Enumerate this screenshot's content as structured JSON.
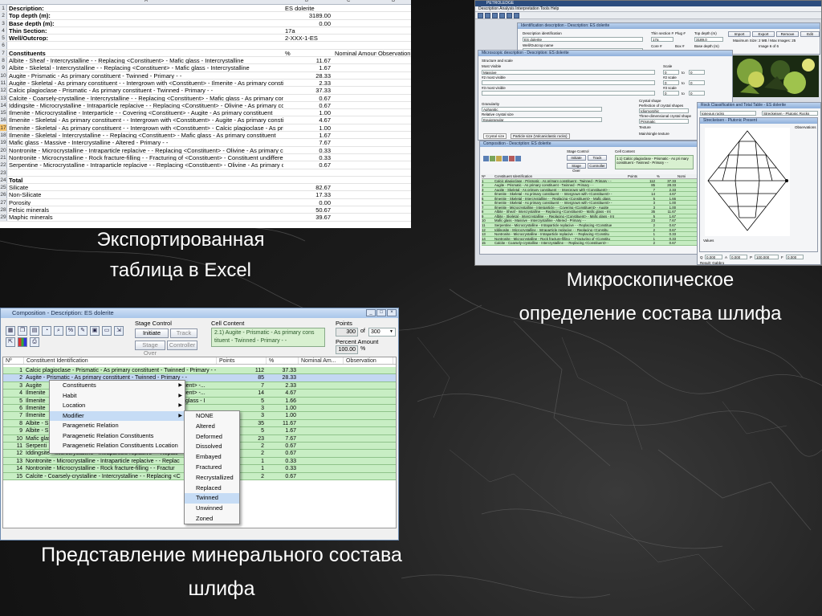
{
  "excel": {
    "col_headers": [
      "A",
      "B",
      "C",
      "D"
    ],
    "rows": [
      {
        "n": "1",
        "a": "Description:",
        "b": "ES dolerite",
        "bl": true,
        "bold": true
      },
      {
        "n": "2",
        "a": "Top depth (m):",
        "b": "3189.00",
        "bold": true
      },
      {
        "n": "3",
        "a": "Base depth (m):",
        "b": "0.00",
        "bold": true
      },
      {
        "n": "4",
        "a": "Thin Section:",
        "b": "17a",
        "bl": true,
        "bold": true
      },
      {
        "n": "5",
        "a": "Well/Outcrop:",
        "b": "2-XXX-1-ES",
        "bl": true,
        "bold": true
      },
      {
        "n": "6",
        "a": ""
      },
      {
        "n": "7",
        "a": "Constituents",
        "b": "%",
        "bl": true,
        "c": "Nominal Amount",
        "d": "Observation",
        "bold": true
      },
      {
        "n": "8",
        "a": "Albite - Sheaf - Intercrystalline - - Replacing <Constituent> - Mafic glass - Intercrystalline",
        "b": "11.67"
      },
      {
        "n": "9",
        "a": "Albite - Skeletal - Intercrystalline - - Replacing <Constituent> - Mafic glass - Intercrystalline",
        "b": "1.67"
      },
      {
        "n": "10",
        "a": "Augite - Prismatic - As primary constituent - Twinned - Primary - -",
        "b": "28.33"
      },
      {
        "n": "11",
        "a": "Augite - Skeletal - As primary constituent - - Intergrown with <Constituent> - Ilmenite - As primary constitu",
        "b": "2.33"
      },
      {
        "n": "12",
        "a": "Calcic plagioclase - Prismatic - As primary constituent - Twinned - Primary - -",
        "b": "37.33"
      },
      {
        "n": "13",
        "a": "Calcite - Coarsely-crystalline - Intercrystalline - - Replacing <Constituent> - Mafic glass - As primary consti",
        "b": "0.67"
      },
      {
        "n": "14",
        "a": "Iddingsite - Microcrystalline - Intraparticle replacive - - Replacing <Constituent> - Olivine - As primary consti",
        "b": "0.67"
      },
      {
        "n": "15",
        "a": "Ilmenite - Microcrystalline - Interparticle - - Covering <Constituent> - Augite - As primary constituent",
        "b": "1.00"
      },
      {
        "n": "16",
        "a": "Ilmenite - Skeletal - As primary constituent - - Intergrown with <Constituent> - Augite - As primary constitu",
        "b": "4.67"
      },
      {
        "n": "17",
        "a": "Ilmenite - Skeletal - As primary constituent - - Intergrown with <Constituent> - Calcic plagioclase - As prim",
        "b": "1.00",
        "sel": true
      },
      {
        "n": "18",
        "a": "Ilmenite - Skeletal - Intercrystalline - - Replacing <Constituent> - Mafic glass - As primary constituent",
        "b": "1.67"
      },
      {
        "n": "19",
        "a": "Mafic glass - Massive - Intercrystalline - Altered - Primary - -",
        "b": "7.67"
      },
      {
        "n": "20",
        "a": "Nontronite - Microcrystalline - Intraparticle replacive - - Replacing <Constituent> - Olivine - As primary cons",
        "b": "0.33"
      },
      {
        "n": "21",
        "a": "Nontronite - Microcrystalline - Rock fracture-filling - - Fracturing of <Constituent> - Constituent undifferentiat",
        "b": "0.33"
      },
      {
        "n": "22",
        "a": "Serpentine - Microcrystalline - Intraparticle replacive - - Replacing <Constituent> - Olivine - As primary cons",
        "b": "0.67"
      },
      {
        "n": "23",
        "a": ""
      },
      {
        "n": "24",
        "a": "Total",
        "bold": true
      },
      {
        "n": "25",
        "a": "Silicate",
        "b": "82.67"
      },
      {
        "n": "26",
        "a": "Non-Silicate",
        "b": "17.33"
      },
      {
        "n": "27",
        "a": "Porosity",
        "b": "0.00"
      },
      {
        "n": "28",
        "a": "Felsic minerals",
        "b": "50.67"
      },
      {
        "n": "29",
        "a": "Maphic minerals",
        "b": "39.67"
      }
    ]
  },
  "captions": {
    "excel_line1": "Экспортированная",
    "excel_line2": "таблица в Excel",
    "micro_line1": "Микроскопическое",
    "micro_line2": "определение состава шлифа",
    "comp_line1": "Представление минерального состава",
    "comp_line2": "шлифа"
  },
  "app": {
    "title": "PETROLEDGE",
    "menu": "Description   Analysis   Interpretation   Tools   Help",
    "ident": {
      "title": "Identification description - Description: ES dolerite",
      "desc_label": "Description identification",
      "desc_value": "ES dolerite",
      "well_label": "Well/Outcrop name",
      "thin_label": "Thin section #",
      "plug_label": "Plug #",
      "top_label": "Top depth (m)",
      "thin_value": "17a",
      "top_value": "3189.0",
      "core_label": "Core #",
      "box_label": "Box #",
      "base_label": "Base depth (m)",
      "import": "Import",
      "export": "Export",
      "remove": "Remove",
      "edit": "Edit",
      "maxsize": "Maximum Size: 2 MB / Max Images: 25",
      "image_of": "Image 6 of 6"
    },
    "micro": {
      "title": "Microscopic description - Description: ES dolerite",
      "structure": "Structure and scale",
      "most_visible": "Most Visible",
      "massive": "Massive",
      "second": "#2 most visible",
      "third": "#3 most visible",
      "scale": "Scale",
      "scale2": "#2 scale",
      "scale3": "#3 scale",
      "to": "to",
      "zero": "0",
      "granularity": "Granularity",
      "aphanitic": "Aphanitic",
      "rel_crystal": "Relative crystal size",
      "equigranular": "Equigranular",
      "crystal_shape": "Crystal shape",
      "perfection": "Perfection of crystal shapes",
      "idiomorphic": "Idiomorphic",
      "three_dim": "Three-dimensional crystal shape",
      "prismatic": "Prismatic",
      "texture": "Texture",
      "main_texture": "Main/single texture",
      "tab1": "Crystal size",
      "tab2": "Particle size (Volcaniclastic rocks)"
    },
    "comp": {
      "title": "Composition - Description: ES dolerite",
      "stage_control": "Stage Control",
      "initiate": "Initiate",
      "track": "Track",
      "stage_over": "Stage Over",
      "controller": "Controller",
      "cell_content": "Cell Content",
      "cell_text": "1.1) Calcic plagioclase - Prismatic - As pri mary constituent - Twinned - Primary - -",
      "headers": [
        "Nº",
        "Constituent Identification",
        "Points",
        "%",
        "Nomi"
      ],
      "rows": [
        [
          "1",
          "Calcic plagioclase - Prismatic - As primary constituent - Twinned - Primary - -",
          "112",
          "37.33"
        ],
        [
          "2",
          "Augite - Prismatic - As primary constituent - Twinned - Primary - -",
          "85",
          "28.33"
        ],
        [
          "3",
          "Augite - Skeletal - As primary constituent - - Intergrown with <Constituent> -",
          "7",
          "2.33"
        ],
        [
          "4",
          "Ilmenite - Skeletal - As primary constituent - - Intergrown with <Constituent> -",
          "14",
          "4.67"
        ],
        [
          "5",
          "Ilmenite - Skeletal - Intercrystalline - - Replacing <Constituent> - Mafic glass",
          "5",
          "1.66"
        ],
        [
          "6",
          "Ilmenite - Skeletal - As primary constituent - - Intergrown with <Constituent> -",
          "3",
          "1.00"
        ],
        [
          "7",
          "Ilmenite - Microcrystalline - Interparticle - - Covering <Constituent> - Augite",
          "3",
          "1.00"
        ],
        [
          "8",
          "Albite - Sheaf - Intercrystalline - - Replacing <Constituent> - Mafic glass - Int",
          "35",
          "11.67"
        ],
        [
          "9",
          "Albite - Skeletal - Intercrystalline - - Replacing <Constituent> - Mafic glass - Int",
          "5",
          "1.67"
        ],
        [
          "10",
          "Mafic glass - Massive - Intercrystalline - Altered - Primary - -",
          "23",
          "7.67"
        ],
        [
          "11",
          "Serpentine - Microcrystalline - Intraparticle replacive - - Replacing <Constitue",
          "2",
          "0.67"
        ],
        [
          "12",
          "Iddingsite - Microcrystalline - Intraparticle replacive - - Replacing <Constitu",
          "2",
          "0.67"
        ],
        [
          "13",
          "Nontronite - Microcrystalline - Intraparticle replacive - - Replacing <Constitu",
          "1",
          "0.33"
        ],
        [
          "14",
          "Nontronite - Microcrystalline - Rock fracture-filling - - Fracturing of <Constitu",
          "1",
          "0.33"
        ],
        [
          "15",
          "Calcite - Coarsely-crystalline - Intercrystalline - - Replacing <Constituent> -",
          "2",
          "0.67"
        ]
      ]
    },
    "rock": {
      "title": "Rock Classification and Total Table - ES dolerite",
      "igneous": "Igneous rocks",
      "streckeisen": "Streckeisen - Plutonic Rocks",
      "diagram_title": "Streckeisen - Plutonic Present",
      "observations": "Observations",
      "values": "Values",
      "q": "Q",
      "a": "A",
      "p": "P",
      "f": "F",
      "q_val": "0.000",
      "a_val": "0.000",
      "p_val": "100.000",
      "f_val": "0.000",
      "result": "Result:  Gabbro"
    }
  },
  "comp": {
    "title": "Composition - Description: ES dolerite",
    "stage_control": "Stage Control",
    "initiate": "Initiate",
    "track": "Track",
    "stage_over": "Stage Over",
    "controller": "Controller",
    "cell_content": "Cell Content",
    "cell_text_1": "2.1) Augite - Prismatic - As primary cons",
    "cell_text_2": "tituent - Twinned - Primary - -",
    "points_label": "Points",
    "points_value": "300",
    "points_of": "of",
    "points_total": "300",
    "percent_label": "Percent Amount",
    "percent_value": "100.00",
    "percent_unit": "%",
    "toolbar_icons": [
      "table-icon",
      "copy-icon",
      "document-icon",
      "chart-icon",
      "zoom-icon",
      "percent-icon",
      "edit-icon",
      "doc-icon",
      "save-icon",
      "export-icon",
      "import-icon",
      "palette-icon",
      "print-icon"
    ],
    "headers": [
      "Nº",
      "Constituent Identification",
      "Points",
      "%",
      "Nominal Am...",
      "Observation"
    ],
    "rows": [
      {
        "n": "1",
        "t": "Calcic plagioclase - Prismatic - As primary constituent - Twinned - Primary - -",
        "p": "112",
        "pc": "37.33"
      },
      {
        "n": "2",
        "t": "Augite - Prismatic - As primary constituent - Twinned - Primary - -",
        "p": "85",
        "pc": "28.33"
      },
      {
        "n": "3",
        "t": "Augite",
        "r": "<Constituent> -...",
        "p": "7",
        "pc": "2.33"
      },
      {
        "n": "4",
        "t": "Ilmenite",
        "r": "<Constituent> -...",
        "p": "14",
        "pc": "4.67"
      },
      {
        "n": "5",
        "t": "Ilmenite",
        "r": "> - Mafic glass - I",
        "p": "5",
        "pc": "1.66"
      },
      {
        "n": "6",
        "t": "Ilmenite",
        "r": "",
        "p": "3",
        "pc": "1.00"
      },
      {
        "n": "7",
        "t": "Ilmenite",
        "r": "",
        "p": "3",
        "pc": "1.00"
      },
      {
        "n": "8",
        "t": "Albite - S",
        "r": "",
        "p": "35",
        "pc": "11.67"
      },
      {
        "n": "9",
        "t": "Albite - S",
        "r": "",
        "p": "5",
        "pc": "1.67"
      },
      {
        "n": "10",
        "t": "Mafic glas",
        "r": "",
        "p": "23",
        "pc": "7.67"
      },
      {
        "n": "11",
        "t": "Serpenti",
        "r": "",
        "p": "2",
        "pc": "0.67"
      },
      {
        "n": "12",
        "t": "Iddingsite - Microcrystalline - Intraparticle replacive - - Replac",
        "p": "2",
        "pc": "0.67"
      },
      {
        "n": "13",
        "t": "Nontronite - Microcrystalline - Intraparticle replacive - - Replac",
        "p": "1",
        "pc": "0.33"
      },
      {
        "n": "14",
        "t": "Nontronite - Microcrystalline - Rock fracture-filling - - Fractur",
        "p": "1",
        "pc": "0.33"
      },
      {
        "n": "15",
        "t": "Calcite - Coarsely-crystalline - Intercrystalline - - Replacing <C",
        "p": "2",
        "pc": "0.67"
      }
    ],
    "context_menu": [
      "Constituents",
      "Habit",
      "Location",
      "Modifier",
      "Paragenetic Relation",
      "Paragenetic Relation Constituents",
      "Paragenetic Relation Constituents Location"
    ],
    "modifier_menu": [
      "NONE",
      "Altered",
      "Deformed",
      "Dissolved",
      "Embayed",
      "Fractured",
      "Recrystallized",
      "Replaced",
      "Twinned",
      "Unwinned",
      "Zoned"
    ]
  }
}
